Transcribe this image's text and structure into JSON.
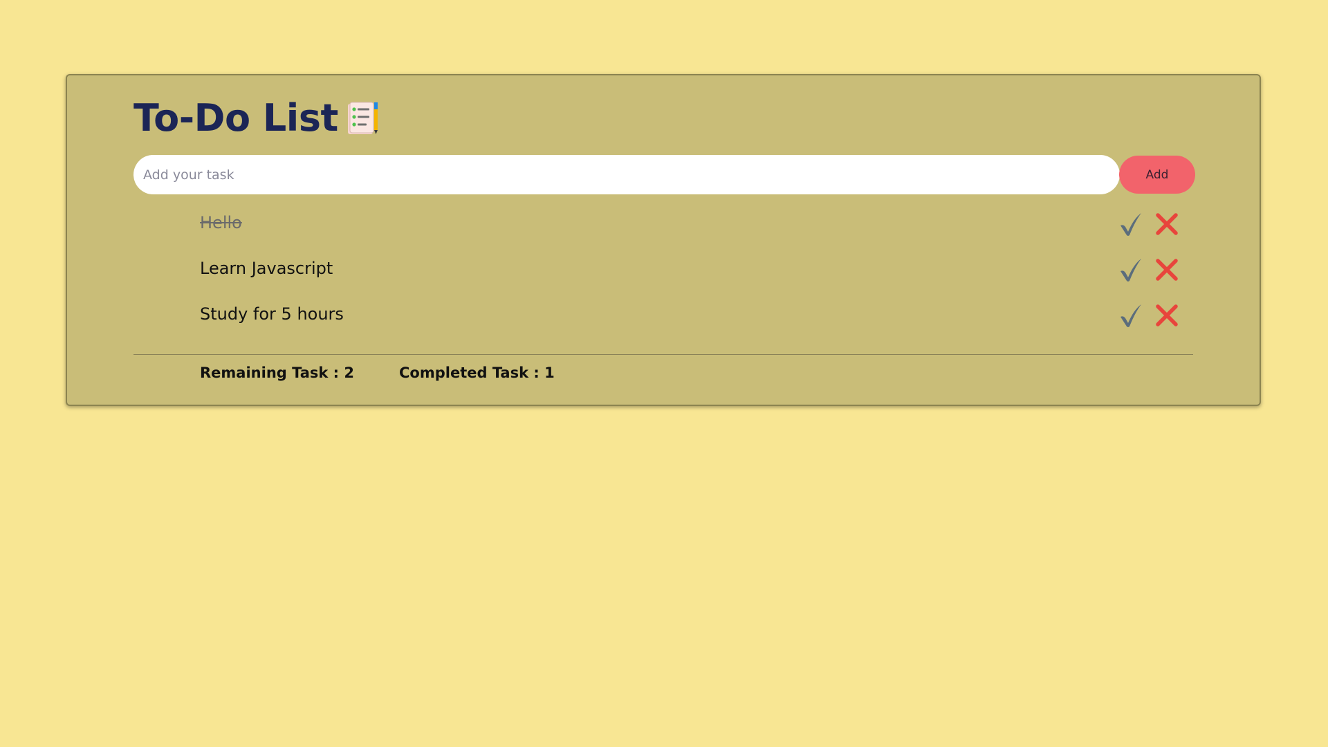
{
  "header": {
    "title": "To-Do List",
    "icon": "notepad-checklist-icon"
  },
  "input": {
    "placeholder": "Add your task",
    "value": "",
    "add_label": "Add"
  },
  "tasks": [
    {
      "text": "Hello",
      "completed": true
    },
    {
      "text": "Learn Javascript",
      "completed": false
    },
    {
      "text": "Study for 5 hours",
      "completed": false
    }
  ],
  "icons": {
    "complete": "check-mark-icon",
    "delete": "cross-mark-icon"
  },
  "stats": {
    "remaining_label": "Remaining Task : 2",
    "completed_label": "Completed Task : 1"
  },
  "colors": {
    "page_background": "#f8e693",
    "card_background": "#c9bd78",
    "title": "#1b2556",
    "add_button": "#f2636b",
    "check": "#5b6d7c",
    "delete": "#e8453c"
  }
}
